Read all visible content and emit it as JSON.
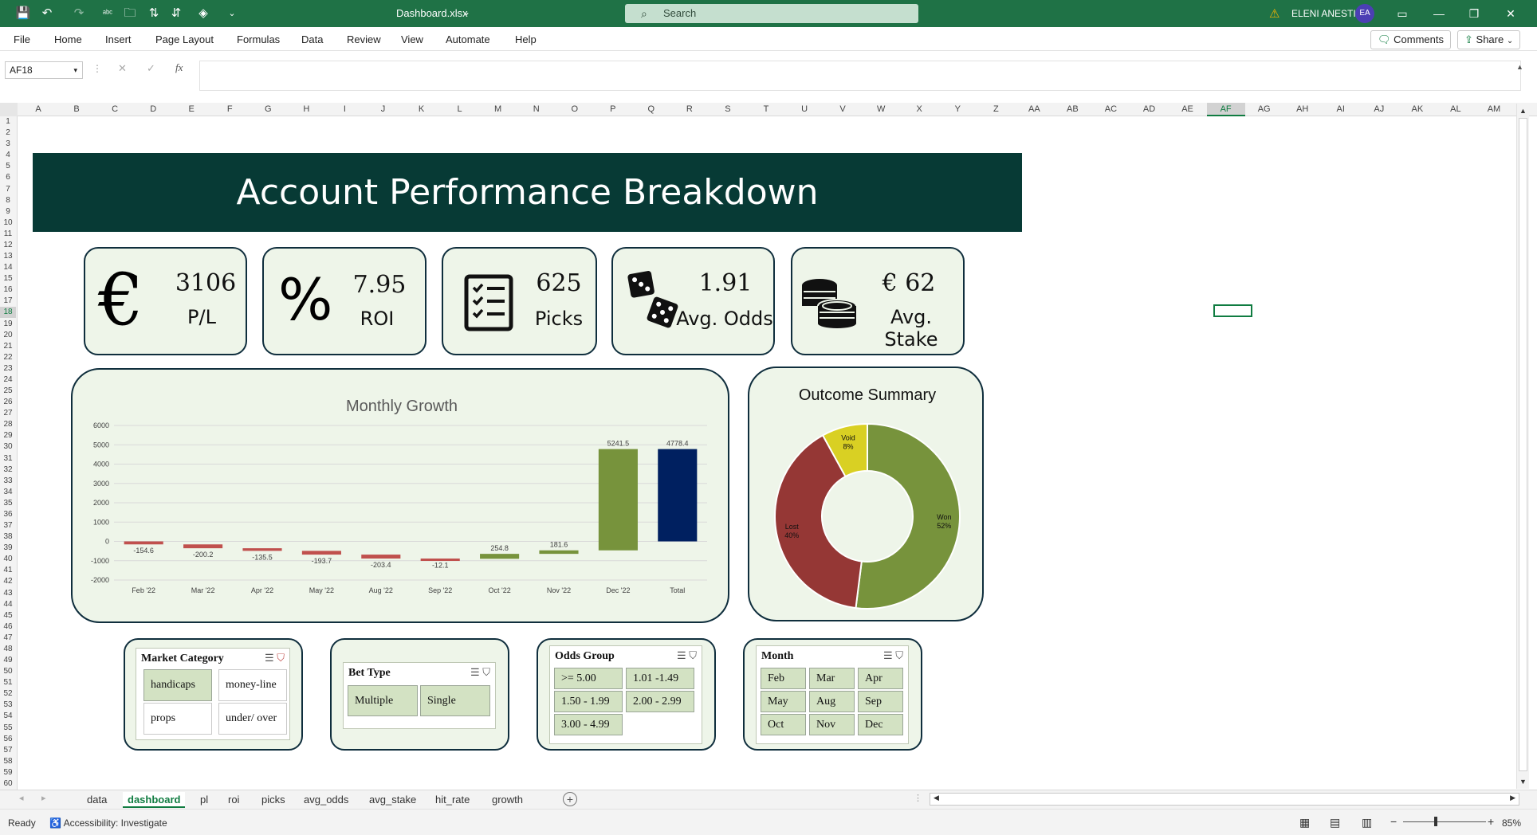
{
  "window": {
    "filename": "Dashboard.xlsx",
    "search_placeholder": "Search",
    "user_name": "ELENI ANESTI",
    "user_initials": "EA"
  },
  "ribbon": {
    "tabs": [
      "File",
      "Home",
      "Insert",
      "Page Layout",
      "Formulas",
      "Data",
      "Review",
      "View",
      "Automate",
      "Help"
    ],
    "comments_label": "Comments",
    "share_label": "Share"
  },
  "formula_bar": {
    "name_box": "AF18",
    "formula": ""
  },
  "grid": {
    "columns": [
      "A",
      "B",
      "C",
      "D",
      "E",
      "F",
      "G",
      "H",
      "I",
      "J",
      "K",
      "L",
      "M",
      "N",
      "O",
      "P",
      "Q",
      "R",
      "S",
      "T",
      "U",
      "V",
      "W",
      "X",
      "Y",
      "Z",
      "AA",
      "AB",
      "AC",
      "AD",
      "AE",
      "AF",
      "AG",
      "AH",
      "AI",
      "AJ",
      "AK",
      "AL",
      "AM"
    ],
    "selected_column": "AF",
    "selected_row": "18",
    "row_count": 60
  },
  "dashboard": {
    "title": "Account Performance Breakdown",
    "kpis": [
      {
        "icon": "euro-icon",
        "value": "3106",
        "label": "P/L"
      },
      {
        "icon": "percent-icon",
        "value": "7.95",
        "label": "ROI"
      },
      {
        "icon": "checklist-icon",
        "value": "625",
        "label": "Picks"
      },
      {
        "icon": "dice-icon",
        "value": "1.91",
        "label": "Avg. Odds"
      },
      {
        "icon": "coins-icon",
        "value": "€ 62",
        "label": "Avg. Stake"
      }
    ]
  },
  "chart_data": [
    {
      "type": "bar",
      "subtype": "waterfall",
      "title": "Monthly Growth",
      "categories": [
        "Feb '22",
        "Mar '22",
        "Apr '22",
        "May '22",
        "Aug '22",
        "Sep '22",
        "Oct '22",
        "Nov '22",
        "Dec '22",
        "Total"
      ],
      "values": [
        -154.6,
        -200.2,
        -135.5,
        -193.7,
        -203.4,
        -12.1,
        254.8,
        181.6,
        5241.5,
        4778.4
      ],
      "data_labels": [
        "-154.6",
        "-200.2",
        "-135.5",
        "-193.7",
        "-203.4",
        "-12.1",
        "254.8",
        "181.6",
        "5241.5",
        "4778.4"
      ],
      "ylim": [
        -2000,
        6000
      ],
      "yticks": [
        -2000,
        -1000,
        0,
        1000,
        2000,
        3000,
        4000,
        5000,
        6000
      ],
      "colors": {
        "increase": "#77933c",
        "decrease": "#c0504d",
        "total": "#002060"
      },
      "grid": true
    },
    {
      "type": "pie",
      "subtype": "donut",
      "title": "Outcome Summary",
      "slices": [
        {
          "label": "Won",
          "value": 52,
          "color": "#77933c"
        },
        {
          "label": "Lost",
          "value": 40,
          "color": "#953735"
        },
        {
          "label": "Void",
          "value": 8,
          "color": "#d9d023"
        }
      ]
    }
  ],
  "slicers": [
    {
      "title": "Market Category",
      "items": [
        {
          "label": "handicaps",
          "selected": true
        },
        {
          "label": "money-line",
          "selected": false
        },
        {
          "label": "props",
          "selected": false
        },
        {
          "label": "under/ over",
          "selected": false
        }
      ]
    },
    {
      "title": "Bet Type",
      "items": [
        {
          "label": "Multiple",
          "selected": true
        },
        {
          "label": "Single",
          "selected": true
        }
      ]
    },
    {
      "title": "Odds Group",
      "items": [
        {
          "label": ">= 5.00",
          "selected": true
        },
        {
          "label": "1.01 -1.49",
          "selected": true
        },
        {
          "label": "1.50 - 1.99",
          "selected": true
        },
        {
          "label": "2.00 - 2.99",
          "selected": true
        },
        {
          "label": "3.00 - 4.99",
          "selected": true
        }
      ]
    },
    {
      "title": "Month",
      "items": [
        {
          "label": "Feb",
          "selected": true
        },
        {
          "label": "Mar",
          "selected": true
        },
        {
          "label": "Apr",
          "selected": true
        },
        {
          "label": "May",
          "selected": true
        },
        {
          "label": "Aug",
          "selected": true
        },
        {
          "label": "Sep",
          "selected": true
        },
        {
          "label": "Oct",
          "selected": true
        },
        {
          "label": "Nov",
          "selected": true
        },
        {
          "label": "Dec",
          "selected": true
        }
      ]
    }
  ],
  "sheets": {
    "tabs": [
      "data",
      "dashboard",
      "pl",
      "roi",
      "picks",
      "avg_odds",
      "avg_stake",
      "hit_rate",
      "growth"
    ],
    "active": "dashboard"
  },
  "status": {
    "ready": "Ready",
    "accessibility": "Accessibility: Investigate",
    "zoom": "85%"
  }
}
